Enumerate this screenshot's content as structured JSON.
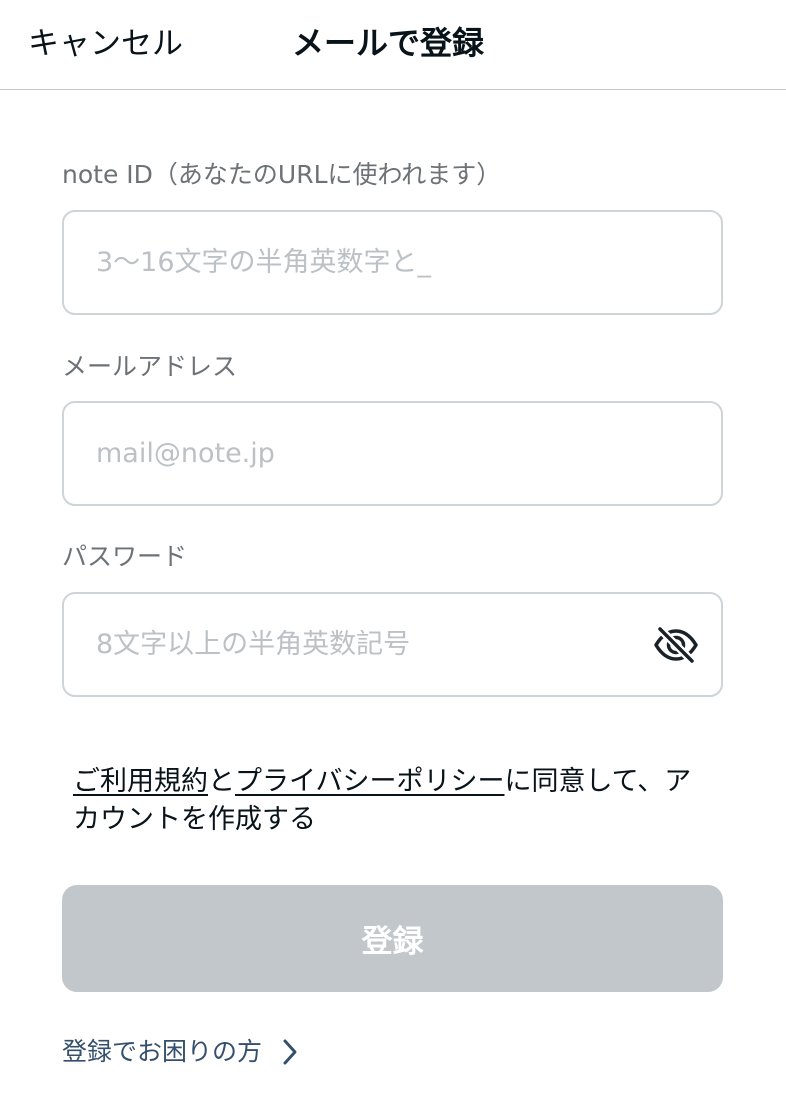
{
  "header": {
    "cancel_label": "キャンセル",
    "title": "メールで登録"
  },
  "form": {
    "note_id": {
      "label": "note ID（あなたのURLに使われます）",
      "placeholder": "3〜16文字の半角英数字と_",
      "value": ""
    },
    "email": {
      "label": "メールアドレス",
      "placeholder": "mail@note.jp",
      "value": ""
    },
    "password": {
      "label": "パスワード",
      "placeholder": "8文字以上の半角英数記号",
      "value": "",
      "visibility_icon": "eye-slash-icon"
    }
  },
  "agreement": {
    "terms_link": "ご利用規約",
    "connector": "と",
    "privacy_link": "プライバシーポリシー",
    "suffix": "に同意して、アカウントを作成する"
  },
  "register_button": {
    "label": "登録"
  },
  "help": {
    "label": "登録でお困りの方",
    "icon": "chevron-right-icon"
  },
  "colors": {
    "text": "#08131a",
    "label": "#6c7276",
    "placeholder": "#bcc1c5",
    "border": "#cfd4d8",
    "button_disabled": "#c1c7cb",
    "link_blue": "#35506c"
  }
}
